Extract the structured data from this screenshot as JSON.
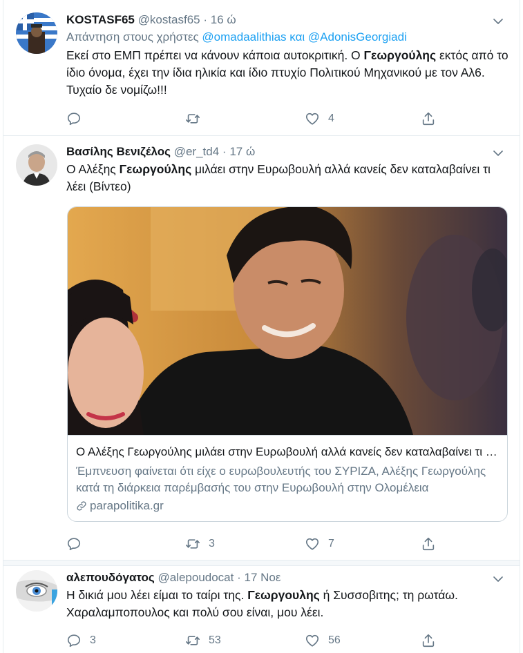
{
  "tweets": [
    {
      "name": "KOSTASF65",
      "handle": "@kostasf65",
      "dot": "·",
      "time": "16 ώ",
      "reply_prefix": "Απάντηση στους χρήστες",
      "reply_mentions": "@omadaalithias και @AdonisGeorgiadi",
      "text_parts": [
        "Εκεί στο ΕΜΠ πρέπει να κάνουν κάποια αυτοκριτική. Ο ",
        "Γεωργούλης",
        " εκτός από το ίδιο όνομα, έχει την ίδια ηλικία και ίδιο πτυχίο Πολιτικού Μηχανικού με τον Αλ6. Τυχαίο δε νομίζω!!!"
      ],
      "replies": "",
      "retweets": "",
      "likes": "4"
    },
    {
      "name": "Βασίλης Βενιζέλος",
      "handle": "@er_td4",
      "dot": "·",
      "time": "17 ώ",
      "text_parts": [
        "Ο Αλέξης ",
        "Γεωργούλης",
        " μιλάει στην Ευρωβουλή αλλά κανείς δεν καταλαβαίνει τι λέει (Βίντεο)"
      ],
      "card": {
        "title": "Ο Αλέξης Γεωργούλης μιλάει στην Ευρωβουλή αλλά κανείς δεν καταλαβαίνει τι λέει (Βίντεο)",
        "description": "Έμπνευση φαίνεται ότι είχε ο ευρωβουλευτής του ΣΥΡΙΖΑ, Αλέξης Γεωργούλης κατά τη διάρκεια παρέμβασής του στην Ευρωβουλή στην Ολομέλεια",
        "domain": "parapolitika.gr"
      },
      "replies": "",
      "retweets": "3",
      "likes": "7"
    },
    {
      "name": "αλεπουδόγατος",
      "handle": "@alepoudocat",
      "dot": "·",
      "time": "17 Νοε",
      "text_parts": [
        "Η δικιά μου λέει είμαι το ταίρι της. ",
        "Γεωργουλης",
        " ή Συσσοβιτης; τη ρωτάω. Χαραλαμποπουλος και πολύ σου είναι, μου λέει."
      ],
      "replies": "3",
      "retweets": "53",
      "likes": "56"
    }
  ],
  "colors": {
    "accent": "#1da1f2",
    "secondary_text": "#657786",
    "border": "#e6ecf0"
  },
  "icons": [
    "reply-icon",
    "retweet-icon",
    "like-icon",
    "share-icon",
    "chevron-down-icon",
    "link-icon"
  ]
}
